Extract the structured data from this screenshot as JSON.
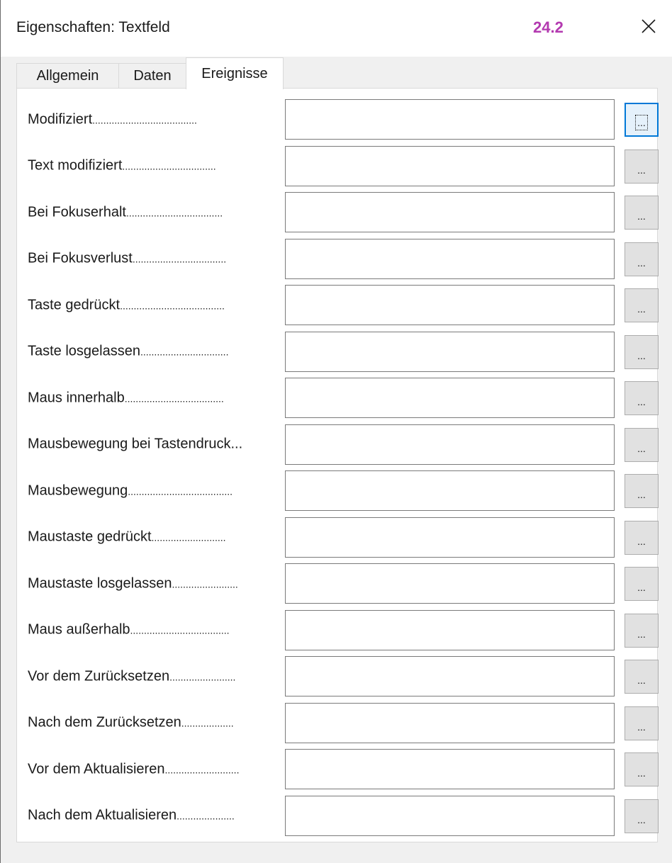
{
  "window": {
    "title": "Eigenschaften: Textfeld",
    "version": "24.2",
    "version_color": "#b33ab0"
  },
  "tabs": [
    {
      "label": "Allgemein",
      "active": false
    },
    {
      "label": "Daten",
      "active": false
    },
    {
      "label": "Ereignisse",
      "active": true
    }
  ],
  "events": [
    {
      "label": "Modifiziert",
      "dots": "......................................",
      "button": "...",
      "value": ""
    },
    {
      "label": "Text modifiziert",
      "dots": "..................................",
      "button": "...",
      "value": ""
    },
    {
      "label": "Bei Fokuserhalt",
      "dots": "...................................",
      "button": "...",
      "value": ""
    },
    {
      "label": "Bei Fokusverlust",
      "dots": "..................................",
      "button": "...",
      "value": ""
    },
    {
      "label": "Taste gedrückt",
      "dots": "......................................",
      "button": "...",
      "value": ""
    },
    {
      "label": "Taste losgelassen",
      "dots": "................................",
      "button": "...",
      "value": ""
    },
    {
      "label": "Maus innerhalb",
      "dots": "....................................",
      "button": "...",
      "value": ""
    },
    {
      "label": "Mausbewegung bei Tastendruck",
      "dots": "...",
      "button": "...",
      "value": ""
    },
    {
      "label": "Mausbewegung",
      "dots": "......................................",
      "button": "...",
      "value": ""
    },
    {
      "label": "Maustaste gedrückt",
      "dots": "...........................",
      "button": "...",
      "value": ""
    },
    {
      "label": "Maustaste losgelassen",
      "dots": "........................",
      "button": "...",
      "value": ""
    },
    {
      "label": "Maus außerhalb",
      "dots": "....................................",
      "button": "...",
      "value": ""
    },
    {
      "label": "Vor dem Zurücksetzen",
      "dots": "........................",
      "button": "...",
      "value": ""
    },
    {
      "label": "Nach dem Zurücksetzen",
      "dots": "...................",
      "button": "...",
      "value": ""
    },
    {
      "label": "Vor dem Aktualisieren",
      "dots": "...........................",
      "button": "...",
      "value": ""
    },
    {
      "label": "Nach dem Aktualisieren",
      "dots": ".....................",
      "button": "...",
      "value": ""
    }
  ]
}
